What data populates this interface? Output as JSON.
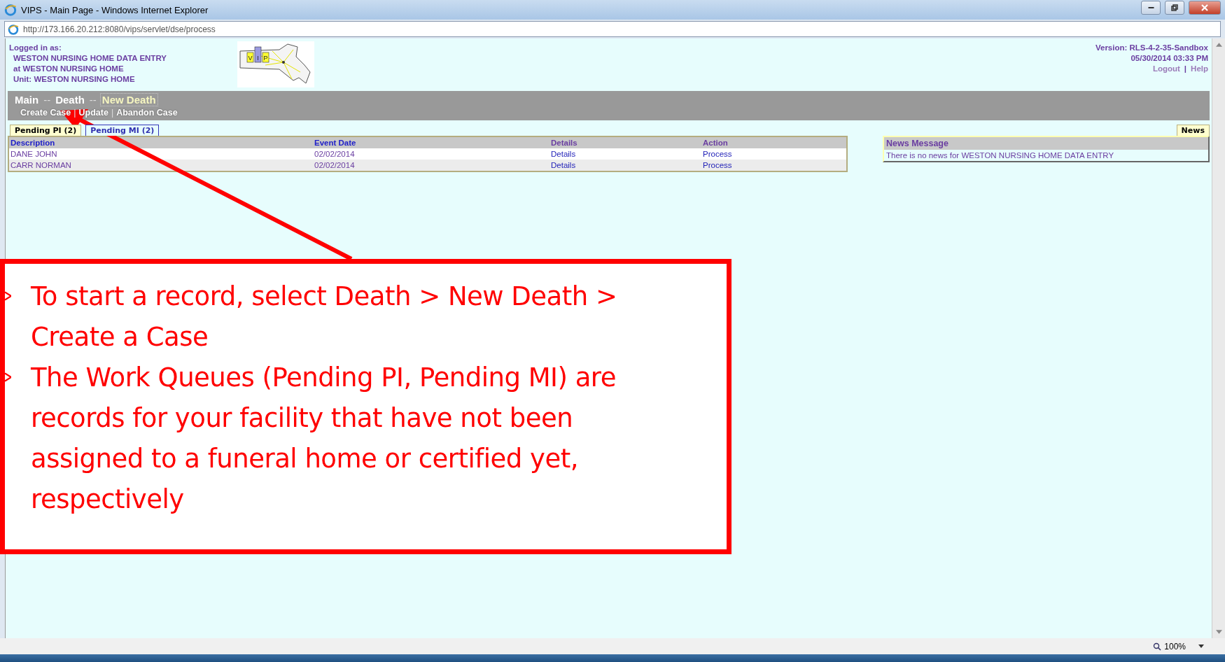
{
  "window": {
    "title": "VIPS - Main Page - Windows Internet Explorer"
  },
  "address_bar": {
    "url": "http://173.166.20.212:8080/vips/servlet/dse/process"
  },
  "header": {
    "logged_in_label": "Logged in as:",
    "user": "WESTON NURSING HOME DATA ENTRY",
    "facility": "at WESTON NURSING HOME",
    "unit": "Unit: WESTON NURSING HOME",
    "logo_letters": [
      "V",
      "I",
      "P"
    ],
    "version": "Version: RLS-4-2-35-Sandbox",
    "timestamp": "05/30/2014 03:33 PM",
    "links": [
      "Logout",
      "Help"
    ],
    "link_separator": "|"
  },
  "breadcrumb": {
    "separator": "--",
    "items": [
      {
        "label": "Main",
        "selected": false
      },
      {
        "label": "Death",
        "selected": false
      },
      {
        "label": "New Death",
        "selected": true
      }
    ]
  },
  "actions": {
    "separator": "|",
    "items": [
      "Create Case",
      "Update",
      "Abandon Case"
    ]
  },
  "tabs": [
    {
      "label": "Pending PI (2)",
      "selected": true
    },
    {
      "label": "Pending MI (2)",
      "selected": false
    }
  ],
  "table": {
    "columns": [
      "Description",
      "Event Date",
      "Details",
      "Action"
    ],
    "rows": [
      {
        "description": "DANE JOHN",
        "event_date": "02/02/2014",
        "details": "Details",
        "action": "Process"
      },
      {
        "description": "CARR NORMAN",
        "event_date": "02/02/2014",
        "details": "Details",
        "action": "Process"
      }
    ]
  },
  "news": {
    "tab_label": "News",
    "heading": "News Message",
    "message": "There is no news for WESTON NURSING HOME DATA ENTRY"
  },
  "annotation": {
    "bullets": [
      "To start a record, select Death > New Death > Create a Case",
      "The Work Queues (Pending PI, Pending MI) are records for your facility that have not been assigned to a funeral home or certified yet, respectively"
    ]
  },
  "status_bar": {
    "zoom": "100%"
  }
}
